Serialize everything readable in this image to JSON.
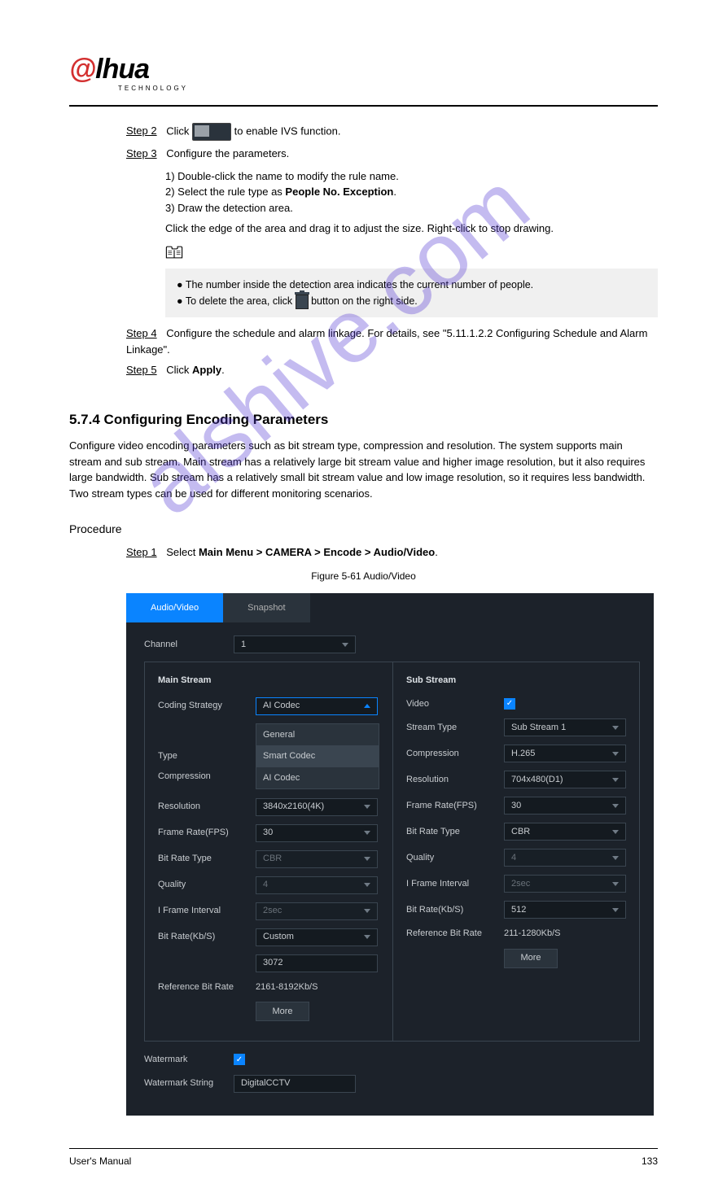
{
  "brand": {
    "char1": "@",
    "rest": "lhua",
    "sub": "TECHNOLOGY"
  },
  "steps": {
    "s2": {
      "label": "Step 2",
      "body_before": "Click ",
      "body_after": " to enable IVS function."
    },
    "s3": {
      "label": "Step 3",
      "body": "Configure the parameters.",
      "sub1": "1) Double-click the name to modify the rule name.",
      "sub2_a": "2) Select the rule type as ",
      "sub2_b": "People No. Exception",
      ".": "",
      "sub3": "3) Draw the detection area.",
      "sub4": "Click the edge of the area and drag it to adjust the size. Right-click to stop drawing.",
      "note_items": [
        "The number inside the detection area indicates the current number of people.",
        "To delete the area, click ",
        " button on the right side."
      ]
    },
    "s4": {
      "label": "Step 4",
      "body": "Configure the schedule and alarm linkage. For details, see \"5.11.1.2.2 Configuring Schedule and Alarm Linkage\"."
    },
    "s5": {
      "label": "Step 5",
      "body_a": "Click ",
      "apply": "Apply",
      "body_b": "."
    }
  },
  "section": {
    "num": "5.7.4",
    "title": " Configuring Encoding Parameters"
  },
  "section_body": "Configure video encoding parameters such as bit stream type, compression and resolution. The system supports main stream and sub stream. Main stream has a relatively large bit stream value and higher image resolution, but it also requires large bandwidth. Sub stream has a relatively small bit stream value and low image resolution, so it requires less bandwidth. Two stream types can be used for different monitoring scenarios.",
  "procedure": {
    "title": "Procedure",
    "s1": {
      "label": "Step 1",
      "body_a": "Select ",
      "menu": "Main Menu > CAMERA > Encode > Audio/Video",
      "body_b": "."
    }
  },
  "figure_caption": "Figure 5-61 Audio/Video",
  "panel": {
    "tabs": {
      "active": "Audio/Video",
      "inactive": "Snapshot"
    },
    "channel": {
      "label": "Channel",
      "value": "1"
    },
    "main": {
      "title": "Main Stream",
      "coding": {
        "label": "Coding Strategy",
        "value": "AI Codec",
        "opts": [
          "General",
          "Smart Codec",
          "AI Codec"
        ]
      },
      "type": {
        "label": "Type"
      },
      "compression": {
        "label": "Compression"
      },
      "resolution": {
        "label": "Resolution",
        "value": "3840x2160(4K)"
      },
      "fps": {
        "label": "Frame Rate(FPS)",
        "value": "30"
      },
      "brtype": {
        "label": "Bit Rate Type",
        "value": "CBR"
      },
      "quality": {
        "label": "Quality",
        "value": "4"
      },
      "iframe": {
        "label": "I Frame Interval",
        "value": "2sec"
      },
      "bitrate": {
        "label": "Bit Rate(Kb/S)",
        "value": "Custom",
        "custom": "3072"
      },
      "refbr": {
        "label": "Reference Bit Rate",
        "value": "2161-8192Kb/S"
      },
      "more": "More"
    },
    "sub": {
      "title": "Sub Stream",
      "video": {
        "label": "Video"
      },
      "streamtype": {
        "label": "Stream Type",
        "value": "Sub Stream 1"
      },
      "compression": {
        "label": "Compression",
        "value": "H.265"
      },
      "resolution": {
        "label": "Resolution",
        "value": "704x480(D1)"
      },
      "fps": {
        "label": "Frame Rate(FPS)",
        "value": "30"
      },
      "brtype": {
        "label": "Bit Rate Type",
        "value": "CBR"
      },
      "quality": {
        "label": "Quality",
        "value": "4"
      },
      "iframe": {
        "label": "I Frame Interval",
        "value": "2sec"
      },
      "bitrate": {
        "label": "Bit Rate(Kb/S)",
        "value": "512"
      },
      "refbr": {
        "label": "Reference Bit Rate",
        "value": "211-1280Kb/S"
      },
      "more": "More"
    },
    "watermark": {
      "label": "Watermark",
      "string_label": "Watermark String",
      "string_value": "DigitalCCTV"
    }
  },
  "footer": {
    "left": "User's Manual",
    "right": "133"
  },
  "watermark_text": "alshive.com"
}
